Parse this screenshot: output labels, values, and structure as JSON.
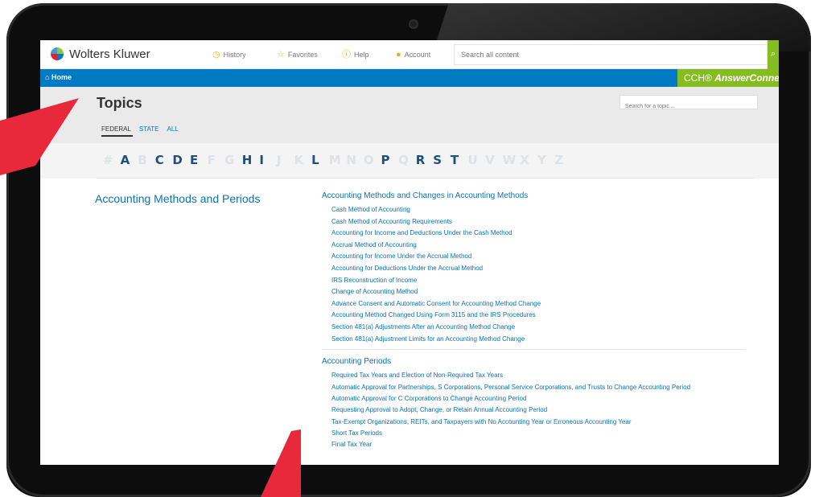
{
  "header": {
    "logo_text": "Wolters Kluwer",
    "nav": [
      {
        "label": "History",
        "icon": "history-icon"
      },
      {
        "label": "Favorites",
        "icon": "star-icon"
      },
      {
        "label": "Help",
        "icon": "help-icon"
      },
      {
        "label": "Account",
        "icon": "account-icon"
      }
    ],
    "search_placeholder": "Search all content"
  },
  "navbar": {
    "home_label": "Home",
    "product_prefix": "CCH®",
    "product_name": "AnswerConnect"
  },
  "topics": {
    "title": "Topics",
    "search_placeholder": "Search for a topic...",
    "tabs": [
      "FEDERAL",
      "STATE",
      "ALL"
    ],
    "active_tab": "FEDERAL"
  },
  "alphabet": {
    "letters": [
      "#",
      "A",
      "B",
      "C",
      "D",
      "E",
      "F",
      "G",
      "H",
      "I",
      "J",
      "K",
      "L",
      "M",
      "N",
      "O",
      "P",
      "Q",
      "R",
      "S",
      "T",
      "U",
      "V",
      "W",
      "X",
      "Y",
      "Z"
    ],
    "enabled": [
      "A",
      "C",
      "D",
      "E",
      "H",
      "I",
      "L",
      "P",
      "R",
      "S",
      "T"
    ]
  },
  "section": {
    "title": "Accounting Methods and Periods",
    "groups": [
      {
        "title": "Accounting Methods and Changes in Accounting Methods",
        "items": [
          "Cash Method of Accounting",
          "Cash Method of Accounting Requirements",
          "Accounting for Income and Deductions Under the Cash Method",
          "Accrual Method of Accounting",
          "Accounting for Income Under the Accrual Method",
          "Accounting for Deductions Under the Accrual Method",
          "IRS Reconstruction of Income",
          "Change of Accounting Method",
          "Advance Consent and Automatic Consent for Accounting Method Change",
          "Accounting Method Changed Using Form 3115 and the IRS Procedures",
          "Section 481(a) Adjustments After an Accounting Method Change",
          "Section 481(a) Adjustment Limits for an Accounting Method Change"
        ]
      },
      {
        "title": "Accounting Periods",
        "items": [
          "Required Tax Years and Election of Non-Required Tax Years",
          "Automatic Approval for Partnerships, S Corporations, Personal Service Corporations, and Trusts to Change Accounting Period",
          "Automatic Approval for C Corporations to Change Accounting Period",
          "Requesting Approval to Adopt, Change, or Retain Annual Accounting Period",
          "Tax-Exempt Organizations, REITs, and Taxpayers with No Accounting Year or Erroneous Accounting Year",
          "Short Tax Periods",
          "Final Tax Year"
        ]
      }
    ]
  },
  "colors": {
    "brand_blue": "#007ac3",
    "brand_green": "#85bc20",
    "link": "#0a72b4",
    "annotation_arrow": "#e8283b"
  }
}
